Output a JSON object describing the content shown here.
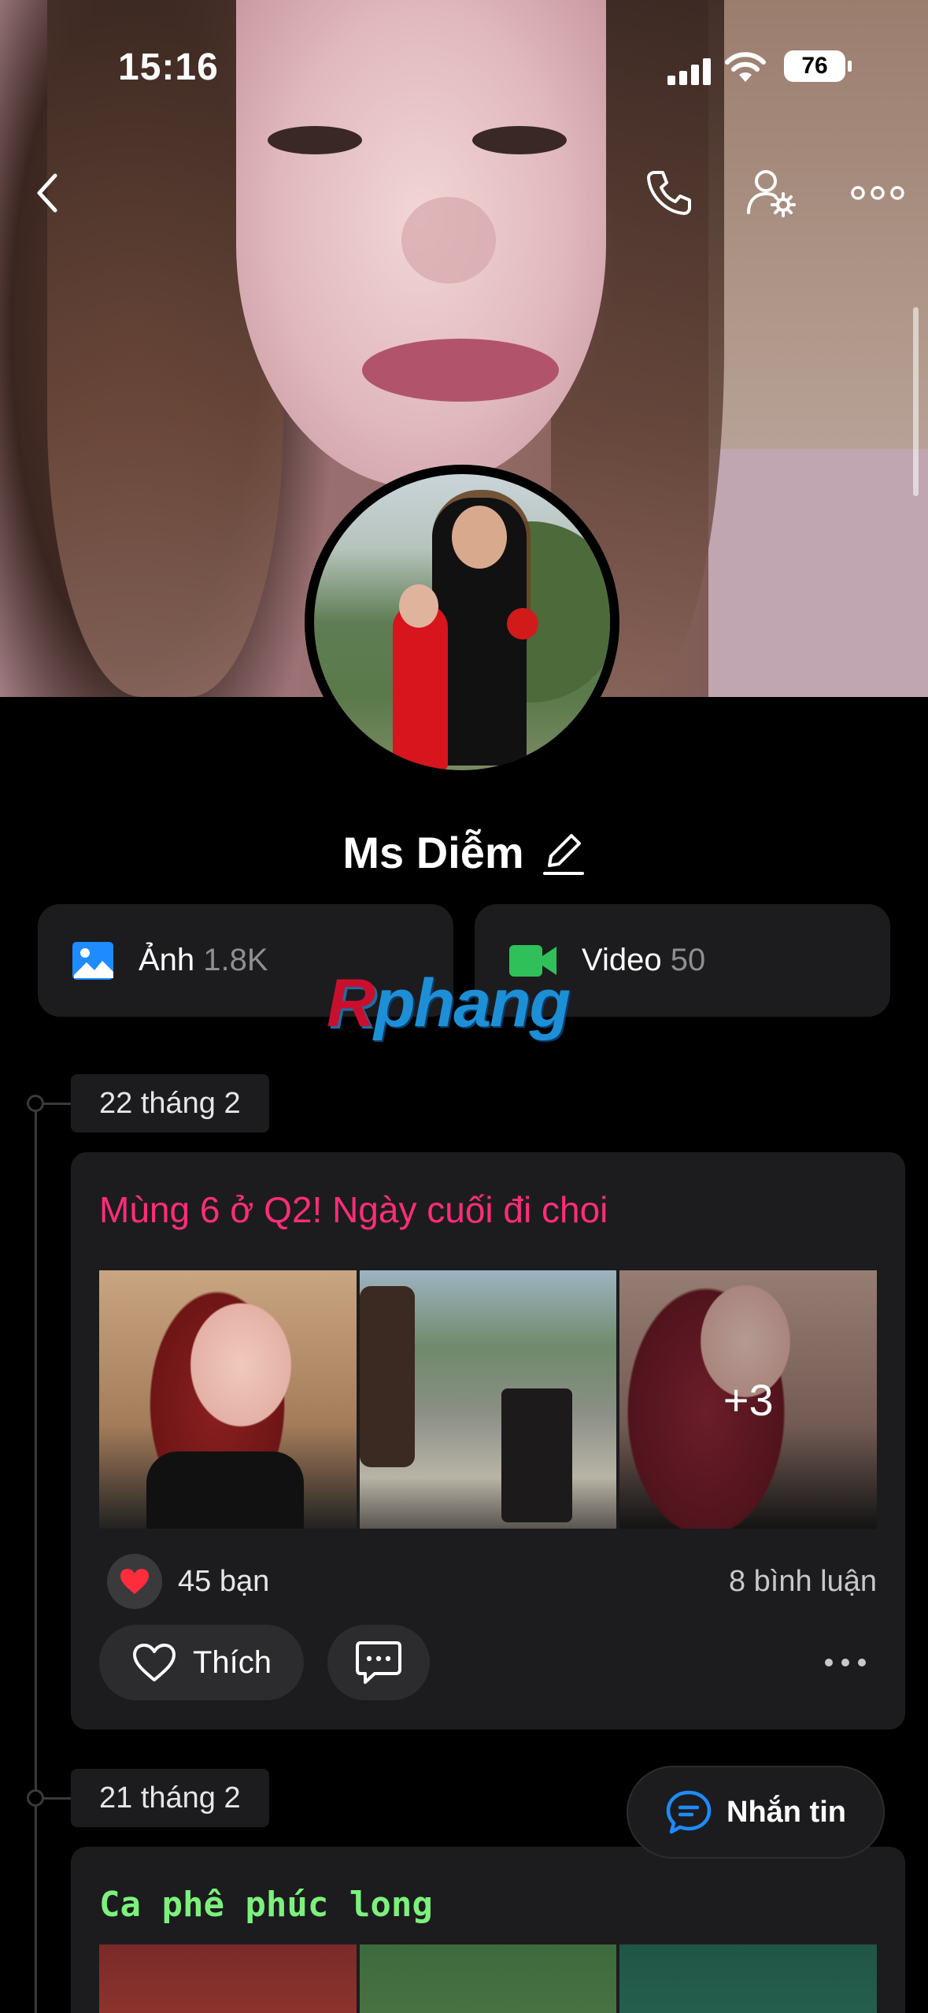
{
  "status_bar": {
    "time": "15:16",
    "battery": "76"
  },
  "profile": {
    "name": "Ms Diễm"
  },
  "media": {
    "photos": {
      "label": "Ảnh",
      "count": "1.8K"
    },
    "videos": {
      "label": "Video",
      "count": "50"
    }
  },
  "watermark": {
    "first": "R",
    "rest": "phang"
  },
  "posts": [
    {
      "date": "22 tháng 2",
      "title": "Mùng 6 ở Q2! Ngày cuối đi choi",
      "title_color": "#ff2d78",
      "more_photos": "+3",
      "reactions": "45 bạn",
      "comments": "8 bình luận",
      "like_label": "Thích"
    },
    {
      "date": "21 tháng 2",
      "title": "Ca phê phúc long",
      "title_color": "#7cf17c"
    }
  ],
  "message_button": {
    "label": "Nhắn tin"
  },
  "colors": {
    "accent_blue": "#1e8bff",
    "video_green": "#30c05a",
    "heart_red": "#ff2d3b"
  }
}
